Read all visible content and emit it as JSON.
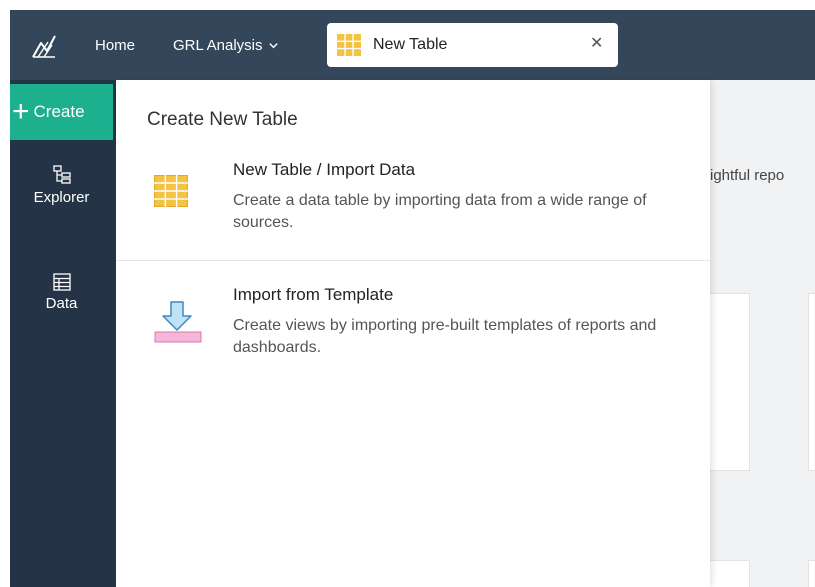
{
  "topbar": {
    "logo_icon": "chart-line-icon",
    "nav_home": "Home",
    "nav_analysis": "GRL Analysis",
    "tab": {
      "label": "New Table",
      "icon": "table-icon",
      "close": "✕"
    }
  },
  "sidebar": {
    "create_label": "Create",
    "items": [
      {
        "label": "Explorer",
        "icon": "explorer-tree-icon"
      },
      {
        "label": "Data",
        "icon": "data-table-icon"
      }
    ]
  },
  "background": {
    "partial_text": "ightful repo"
  },
  "dropdown": {
    "title": "Create New Table",
    "items": [
      {
        "title": "New Table / Import Data",
        "description": "Create a data table by importing data from a wide range of sources.",
        "icon": "grid-table-icon"
      },
      {
        "title": "Import from Template",
        "description": "Create views by importing pre-built templates of reports and dashboards.",
        "icon": "import-template-icon"
      }
    ]
  },
  "colors": {
    "topbar": "#34465a",
    "sidebar": "#243446",
    "create_button": "#1cb08f",
    "table_icon": "#f5c342"
  }
}
